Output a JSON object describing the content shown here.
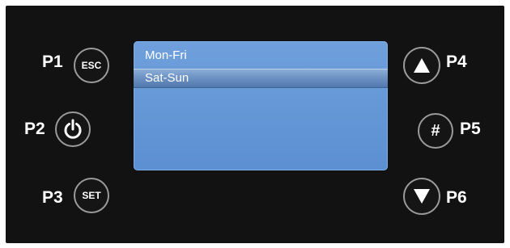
{
  "buttons": {
    "p1": {
      "label": "P1",
      "text": "ESC",
      "icon": "esc-text"
    },
    "p2": {
      "label": "P2",
      "icon": "power-icon"
    },
    "p3": {
      "label": "P3",
      "text": "SET",
      "icon": "set-text"
    },
    "p4": {
      "label": "P4",
      "icon": "triangle-up-icon"
    },
    "p5": {
      "label": "P5",
      "text": "#",
      "icon": "hash-text"
    },
    "p6": {
      "label": "P6",
      "icon": "triangle-down-icon"
    }
  },
  "screen": {
    "items": [
      {
        "label": "Mon-Fri",
        "selected": false
      },
      {
        "label": "Sat-Sun",
        "selected": true
      }
    ]
  },
  "colors": {
    "panel": "#121212",
    "screen": "#6296d6",
    "selection": "#6e93c4",
    "button_ring": "#9a9a9a"
  }
}
